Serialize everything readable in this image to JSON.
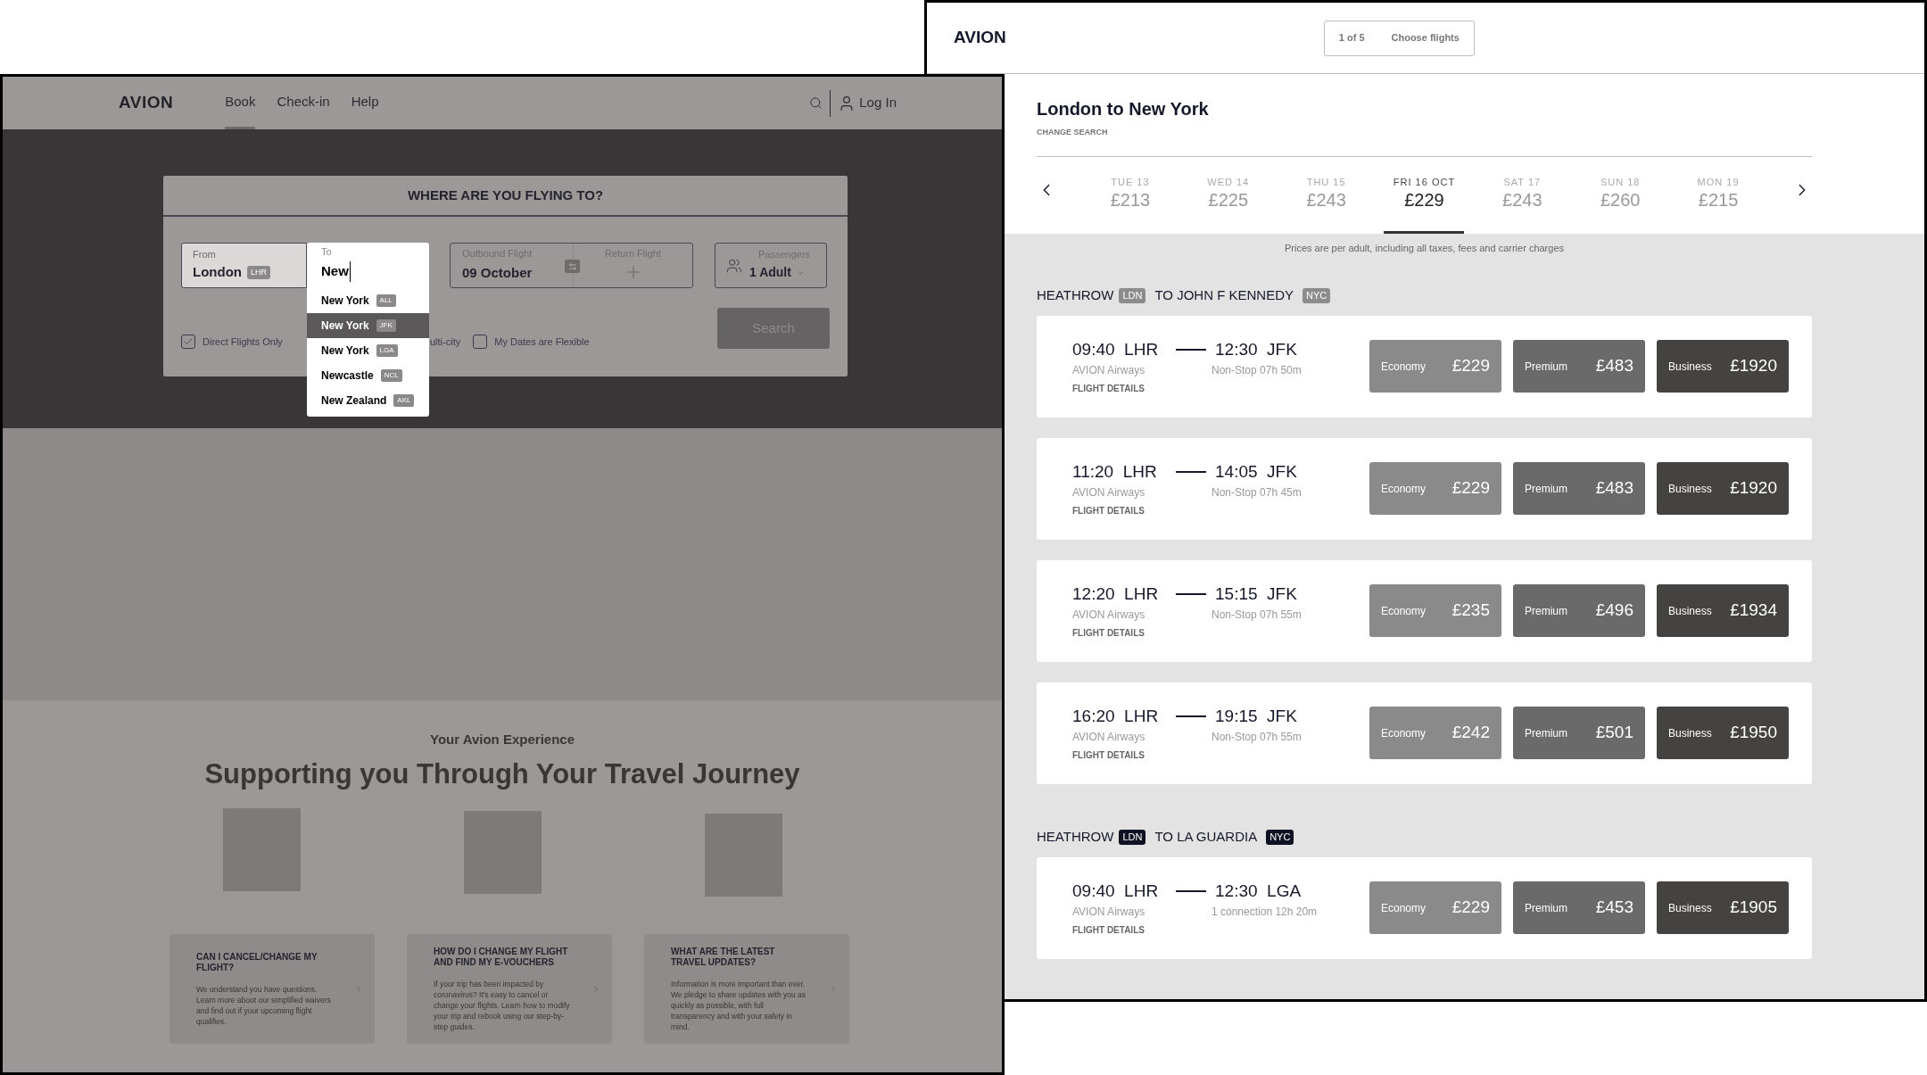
{
  "search_window": {
    "nav": {
      "logo": "AVION",
      "links": [
        {
          "label": "Book",
          "selected": true
        },
        {
          "label": "Check-in",
          "selected": false
        },
        {
          "label": "Help",
          "selected": false
        }
      ],
      "login": "Log In"
    },
    "search_panel": {
      "title": "WHERE ARE YOU FLYING TO?",
      "from": {
        "label": "From",
        "value": "London",
        "code": "LHR"
      },
      "to": {
        "label": "To",
        "value": "New"
      },
      "suggestions": [
        {
          "city": "New York",
          "code": "ALL",
          "selected": false
        },
        {
          "city": "New York",
          "code": "JFK",
          "selected": true
        },
        {
          "city": "New York",
          "code": "LGA",
          "selected": false
        },
        {
          "city": "Newcastle",
          "code": "NCL",
          "selected": false
        },
        {
          "city": "New Zealand",
          "code": "AKL",
          "selected": false
        }
      ],
      "outbound": {
        "label": "Outbound Flight",
        "value": "09 October"
      },
      "return": {
        "label": "Return Flight"
      },
      "passengers": {
        "label": "Passengers",
        "value": "1 Adult"
      },
      "direct_option": {
        "label": "Direct Flights Only",
        "checked": true
      },
      "partial_option": "ulti-city",
      "flexible_option": {
        "label": "My Dates are Flexible",
        "checked": false
      },
      "search_button": "Search"
    },
    "experience": {
      "eyebrow": "Your Avion Experience",
      "heading": "Supporting you Through Your Travel Journey",
      "cards": [
        {
          "title": "CAN I CANCEL/CHANGE MY FLIGHT?",
          "body": "We understand you have questions. Learn more about our simplified waivers and find out if your upcoming flight qualifies."
        },
        {
          "title": "HOW DO I CHANGE MY FLIGHT AND FIND MY E-VOUCHERS",
          "body": "If your trip has been impacted by coronavirus? It's easy to cancel or change your flights. Learn how to modify your trip and rebook using our step-by-step guides."
        },
        {
          "title": "WHAT ARE THE LATEST TRAVEL UPDATES?",
          "body": "Information is more important than ever. We pledge to share updates with you as quickly as possible, with full transparency and with your safety in mind."
        }
      ]
    }
  },
  "results_window": {
    "logo": "AVION",
    "step": "1 of 5",
    "step_title": "Choose flights",
    "route_title": "London to New York",
    "change_search": "CHANGE SEARCH",
    "dates": [
      {
        "day": "TUE 13",
        "price": "£213",
        "selected": false
      },
      {
        "day": "WED 14",
        "price": "£225",
        "selected": false
      },
      {
        "day": "THU 15",
        "price": "£243",
        "selected": false
      },
      {
        "day": "FRI 16 OCT",
        "price": "£229",
        "selected": true
      },
      {
        "day": "SAT 17",
        "price": "£243",
        "selected": false
      },
      {
        "day": "SUN 18",
        "price": "£260",
        "selected": false
      },
      {
        "day": "MON 19",
        "price": "£215",
        "selected": false
      }
    ],
    "note": "Prices are per adult, including all taxes, fees and carrier charges",
    "groups": [
      {
        "from": "HEATHROW",
        "from_code": "LDN",
        "to": "TO JOHN F KENNEDY",
        "to_code": "NYC",
        "color": "#8c8c8c",
        "flights": [
          {
            "depart": "09:40",
            "from": "LHR",
            "arrive": "12:30",
            "to": "JFK",
            "airline": "AVION Airways",
            "details": "FLIGHT DETAILS",
            "info": "Non-Stop 07h 50m",
            "fares": [
              {
                "kind": "economy",
                "label": "Economy",
                "price": "£229"
              },
              {
                "kind": "premium",
                "label": "Premium",
                "price": "£483"
              },
              {
                "kind": "business",
                "label": "Business",
                "price": "£1920"
              }
            ]
          },
          {
            "depart": "11:20",
            "from": "LHR",
            "arrive": "14:05",
            "to": "JFK",
            "airline": "AVION Airways",
            "details": "FLIGHT DETAILS",
            "info": "Non-Stop 07h 45m",
            "fares": [
              {
                "kind": "economy",
                "label": "Economy",
                "price": "£229"
              },
              {
                "kind": "premium",
                "label": "Premium",
                "price": "£483"
              },
              {
                "kind": "business",
                "label": "Business",
                "price": "£1920"
              }
            ]
          },
          {
            "depart": "12:20",
            "from": "LHR",
            "arrive": "15:15",
            "to": "JFK",
            "airline": "AVION Airways",
            "details": "FLIGHT DETAILS",
            "info": "Non-Stop 07h 55m",
            "fares": [
              {
                "kind": "economy",
                "label": "Economy",
                "price": "£235"
              },
              {
                "kind": "premium",
                "label": "Premium",
                "price": "£496"
              },
              {
                "kind": "business",
                "label": "Business",
                "price": "£1934"
              }
            ]
          },
          {
            "depart": "16:20",
            "from": "LHR",
            "arrive": "19:15",
            "to": "JFK",
            "airline": "AVION Airways",
            "details": "FLIGHT DETAILS",
            "info": "Non-Stop 07h 55m",
            "fares": [
              {
                "kind": "economy",
                "label": "Economy",
                "price": "£242"
              },
              {
                "kind": "premium",
                "label": "Premium",
                "price": "£501"
              },
              {
                "kind": "business",
                "label": "Business",
                "price": "£1950"
              }
            ]
          }
        ]
      },
      {
        "from": "HEATHROW",
        "from_code": "LDN",
        "to": "TO LA GUARDIA",
        "to_code": "NYC",
        "color": "#0f1222",
        "flights": [
          {
            "depart": "09:40",
            "from": "LHR",
            "arrive": "12:30",
            "to": "LGA",
            "airline": "AVION Airways",
            "details": "FLIGHT DETAILS",
            "info": "1 connection 12h 20m",
            "fares": [
              {
                "kind": "economy",
                "label": "Economy",
                "price": "£229"
              },
              {
                "kind": "premium",
                "label": "Premium",
                "price": "£453"
              },
              {
                "kind": "business",
                "label": "Business",
                "price": "£1905"
              }
            ]
          }
        ]
      }
    ]
  }
}
